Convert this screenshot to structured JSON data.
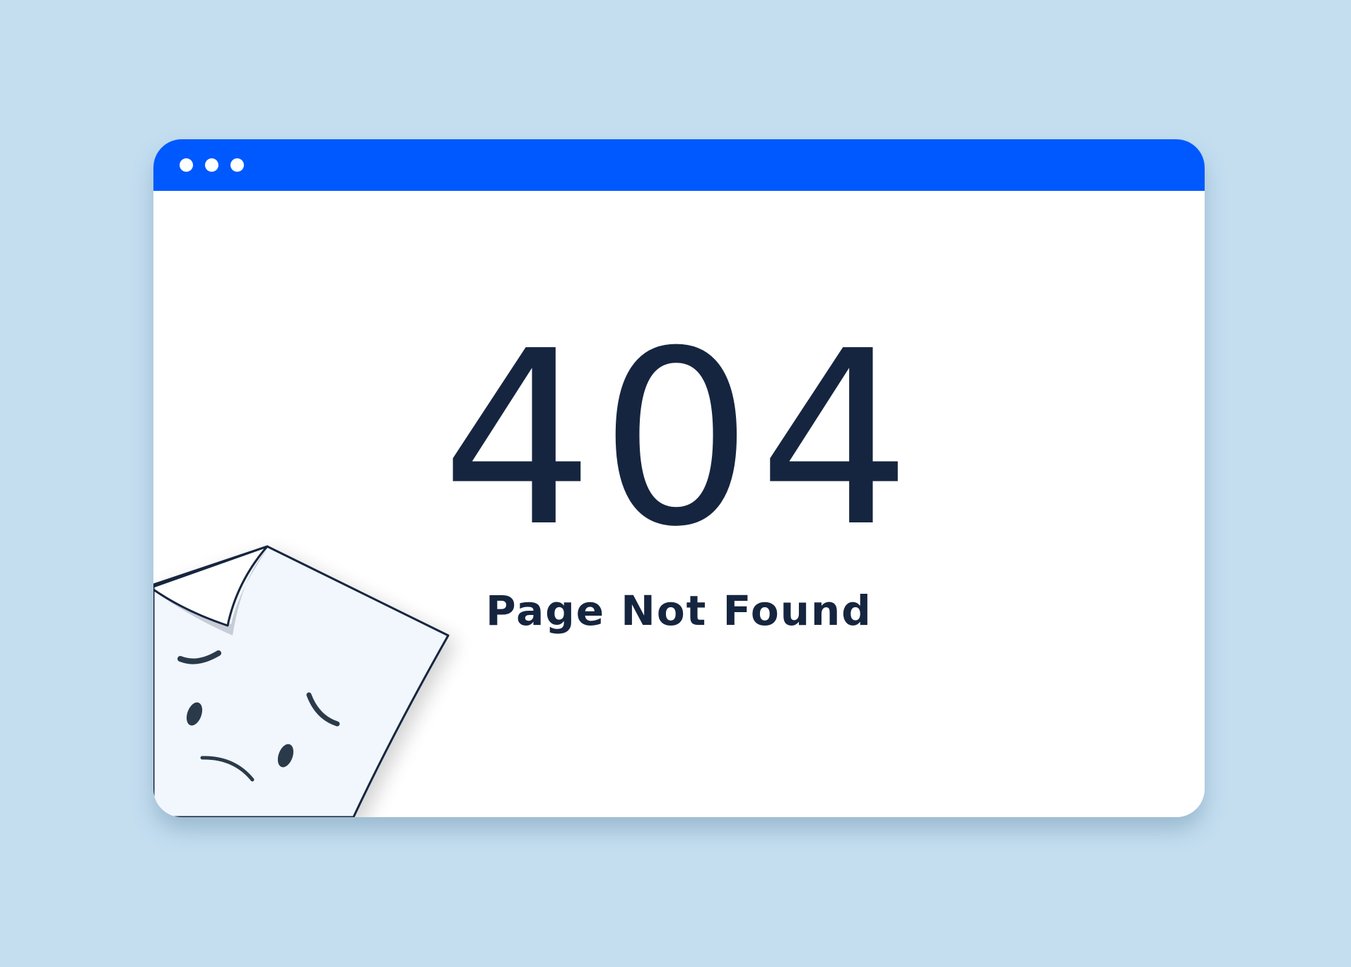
{
  "window": {
    "titlebar_color": "#0059ff",
    "controls": [
      "dot",
      "dot",
      "dot"
    ]
  },
  "error": {
    "code": "404",
    "message": "Page Not Found"
  },
  "illustration": {
    "icon": "sad-page-icon"
  }
}
